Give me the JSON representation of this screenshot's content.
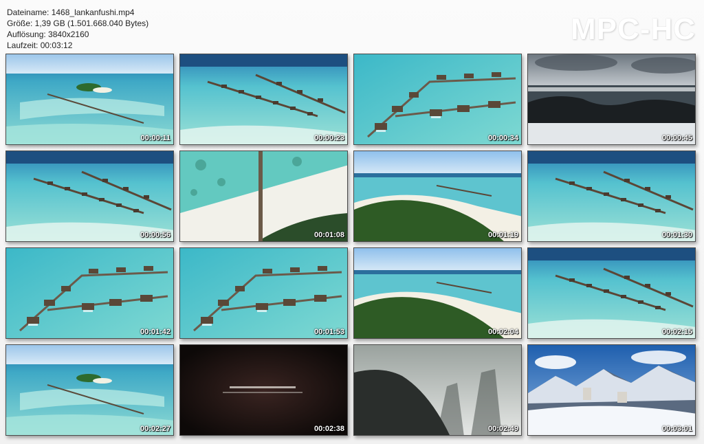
{
  "header": {
    "filename": "Dateiname: 1468_lankanfushi.mp4",
    "size": "Größe: 1,39 GB (1.501.668.040 Bytes)",
    "resolution": "Auflösung: 3840x2160",
    "duration": "Laufzeit: 00:03:12"
  },
  "logo": "MPC-HC",
  "thumbnails": [
    {
      "time": "00:00:11",
      "scene": "aerial-lagoon"
    },
    {
      "time": "00:00:23",
      "scene": "aerial-piers"
    },
    {
      "time": "00:00:34",
      "scene": "aerial-villas"
    },
    {
      "time": "00:00:45",
      "scene": "sunset-coast"
    },
    {
      "time": "00:00:56",
      "scene": "aerial-piers"
    },
    {
      "time": "00:01:08",
      "scene": "top-down-beach"
    },
    {
      "time": "00:01:19",
      "scene": "island-jungle"
    },
    {
      "time": "00:01:30",
      "scene": "aerial-piers"
    },
    {
      "time": "00:01:42",
      "scene": "aerial-villas"
    },
    {
      "time": "00:01:53",
      "scene": "aerial-villas"
    },
    {
      "time": "00:02:04",
      "scene": "island-jungle"
    },
    {
      "time": "00:02:15",
      "scene": "aerial-piers"
    },
    {
      "time": "00:02:27",
      "scene": "aerial-lagoon"
    },
    {
      "time": "00:02:38",
      "scene": "dark-title"
    },
    {
      "time": "00:02:49",
      "scene": "misty-cliffs"
    },
    {
      "time": "00:03:01",
      "scene": "snow-mountains"
    }
  ]
}
